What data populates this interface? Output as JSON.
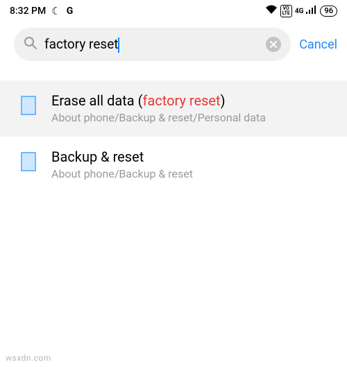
{
  "statusbar": {
    "time": "8:32 PM",
    "moon": "☾",
    "g": "G",
    "wifi": "wifi",
    "volte": "VO LTE",
    "nettype": "4G",
    "battery": "96"
  },
  "search": {
    "query": "factory reset",
    "cancel": "Cancel"
  },
  "results": [
    {
      "title_pre": "Erase all data (",
      "title_match": "factory reset",
      "title_post": ")",
      "path": "About phone/Backup & reset/Personal data",
      "highlighted": true
    },
    {
      "title_pre": "Backup & reset",
      "title_match": "",
      "title_post": "",
      "path": "About phone/Backup & reset",
      "highlighted": false
    }
  ],
  "watermark": "wsxdn.com"
}
